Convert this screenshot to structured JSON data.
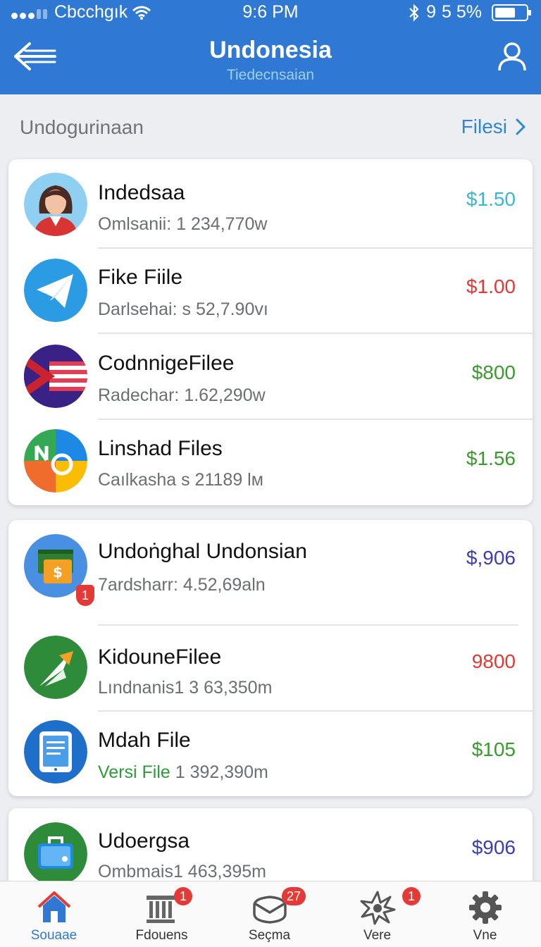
{
  "status": {
    "carrier": "Cbcchgık",
    "time": "9:6 PM",
    "bluetooth": "bluetooth-icon",
    "mid": "9",
    "battery": "5 5%"
  },
  "header": {
    "title": "Undonesia",
    "subtitle": "Tiedecnsaian"
  },
  "section": {
    "title": "Undogurinaan",
    "link": "Filesi"
  },
  "groups": [
    {
      "items": [
        {
          "name": "Indedsaa",
          "meta": "Omlsanii: 1 234,770w",
          "price": "$1.50",
          "price_color": "#3ab7d6",
          "icon": "avatar-icon"
        },
        {
          "name": "Fike Fiile",
          "meta": "Darlsehai: s 52,7.90vı",
          "price": "$1.00",
          "price_color": "#e53935",
          "icon": "paper-plane-icon"
        },
        {
          "name": "CodnnigeFilee",
          "meta": "Radechar: 1.62,290w",
          "price": "$800",
          "price_color": "#3a9a2f",
          "icon": "flag-icon"
        },
        {
          "name": "Linshad Files",
          "meta": "Caılkasha s 21189 lм",
          "price": "$1.56",
          "price_color": "#3a9a2f",
          "icon": "no-logo-icon"
        }
      ]
    },
    {
      "items": [
        {
          "name": "Undoṅghal Undonsian",
          "meta": "7ardsharr: 4.52,69aln",
          "price": "$,906",
          "price_color": "#3d3db3",
          "icon": "money-folder-icon",
          "icon_badge": "1"
        },
        {
          "name": "KidouneFilee",
          "meta": "Lındnanis1 3 63,350m",
          "price": "9800",
          "price_color": "#e53935",
          "icon": "arrow-leaf-icon"
        },
        {
          "name": "Mdah File",
          "meta_prefix": "Versi File",
          "meta": " 1 392,390m",
          "price": "$105",
          "price_color": "#3a9a2f",
          "icon": "tablet-icon"
        }
      ]
    },
    {
      "items": [
        {
          "name": "Udoergsa",
          "meta": "Ombmais1 463,395m",
          "price": "$906",
          "price_color": "#3d3db3",
          "icon": "briefcase-icon"
        }
      ]
    }
  ],
  "tabs": [
    {
      "label": "Souaae",
      "icon": "home-icon",
      "active": true
    },
    {
      "label": "Fdouens",
      "icon": "bank-icon",
      "badge": "1"
    },
    {
      "label": "Seçma",
      "icon": "mail-icon",
      "badge": "27"
    },
    {
      "label": "Vere",
      "icon": "star-burst-icon",
      "badge": "1"
    },
    {
      "label": "Vne",
      "icon": "gear-icon"
    }
  ],
  "colors": {
    "header": "#2f78d3",
    "link": "#2f86d6",
    "background": "#eceef1",
    "badge": "#e53935"
  }
}
